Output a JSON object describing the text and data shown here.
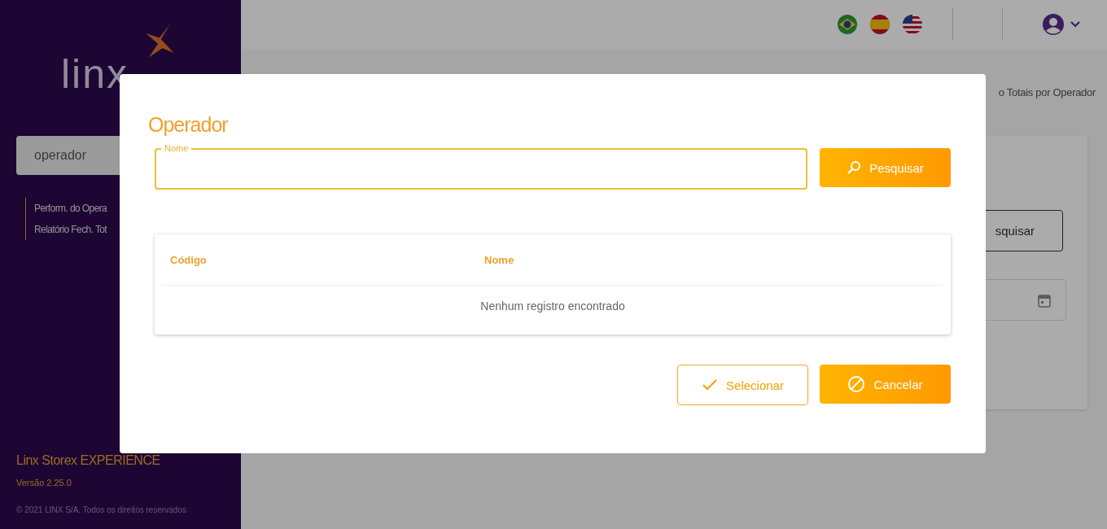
{
  "sidebar": {
    "logo": {
      "text": "linx"
    },
    "search": {
      "value": "operador"
    },
    "items": [
      {
        "label": "Perform. do Opera"
      },
      {
        "label": "Relatório Fech. Tot"
      }
    ],
    "product": "Linx Storex EXPERIENCE",
    "version": "Versão 2.25.0",
    "copyright": "© 2021 LINX S/A. Todos os direitos reservados"
  },
  "topbar": {
    "languages": [
      {
        "kind": "br"
      },
      {
        "kind": "es"
      },
      {
        "kind": "us"
      }
    ]
  },
  "page": {
    "breadcrumb": "o Totais por Operador",
    "search_button": "squisar"
  },
  "dialog": {
    "title": "Operador",
    "field": {
      "label": "Nome"
    },
    "search_button": "Pesquisar",
    "table": {
      "columns": [
        "Código",
        "Nome"
      ],
      "empty": "Nenhum registro encontrado"
    },
    "buttons": [
      {
        "kind": "outline",
        "label": "Selecionar"
      },
      {
        "kind": "filled",
        "label": "Cancelar"
      }
    ]
  }
}
